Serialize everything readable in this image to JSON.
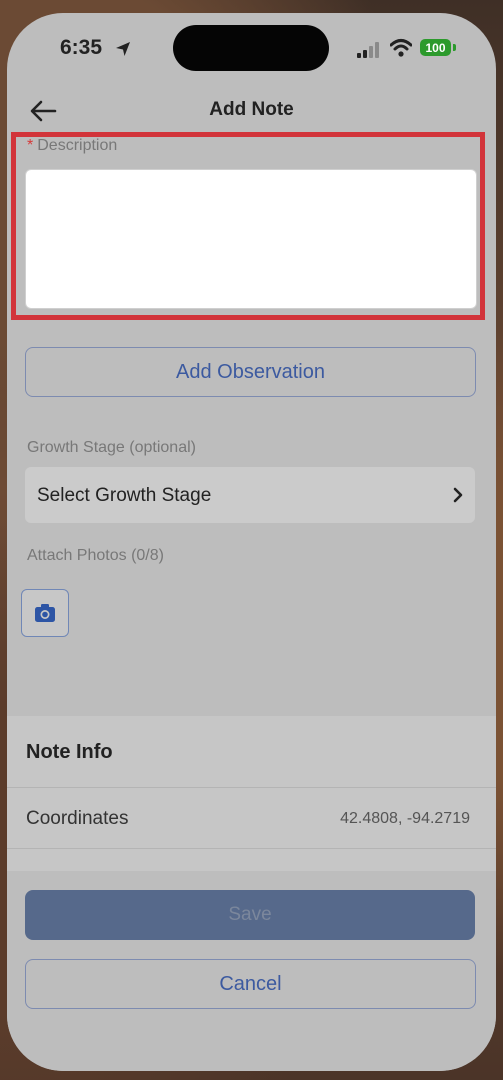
{
  "status_bar": {
    "time": "6:35",
    "battery": "100",
    "icons": [
      "location-arrow-icon",
      "signal-icon",
      "wifi-icon",
      "battery-icon"
    ]
  },
  "header": {
    "title": "Add Note",
    "back_icon": "back-arrow-icon"
  },
  "form": {
    "description_required_mark": "*",
    "description_label": "Description",
    "description_value": "",
    "add_observation_label": "Add Observation",
    "growth_stage_label": "Growth Stage (optional)",
    "growth_stage_select_text": "Select Growth Stage",
    "attach_photos_label": "Attach Photos (0/8)",
    "camera_icon": "camera-icon"
  },
  "note_info": {
    "title": "Note Info",
    "coordinates_label": "Coordinates",
    "coordinates_value": "42.4808, -94.2719"
  },
  "footer": {
    "save_label": "Save",
    "cancel_label": "Cancel"
  },
  "colors": {
    "accent": "#3c5aa0",
    "highlight": "#d2343a",
    "save_button_bg": "#56698b",
    "battery": "#2c9a2c"
  }
}
